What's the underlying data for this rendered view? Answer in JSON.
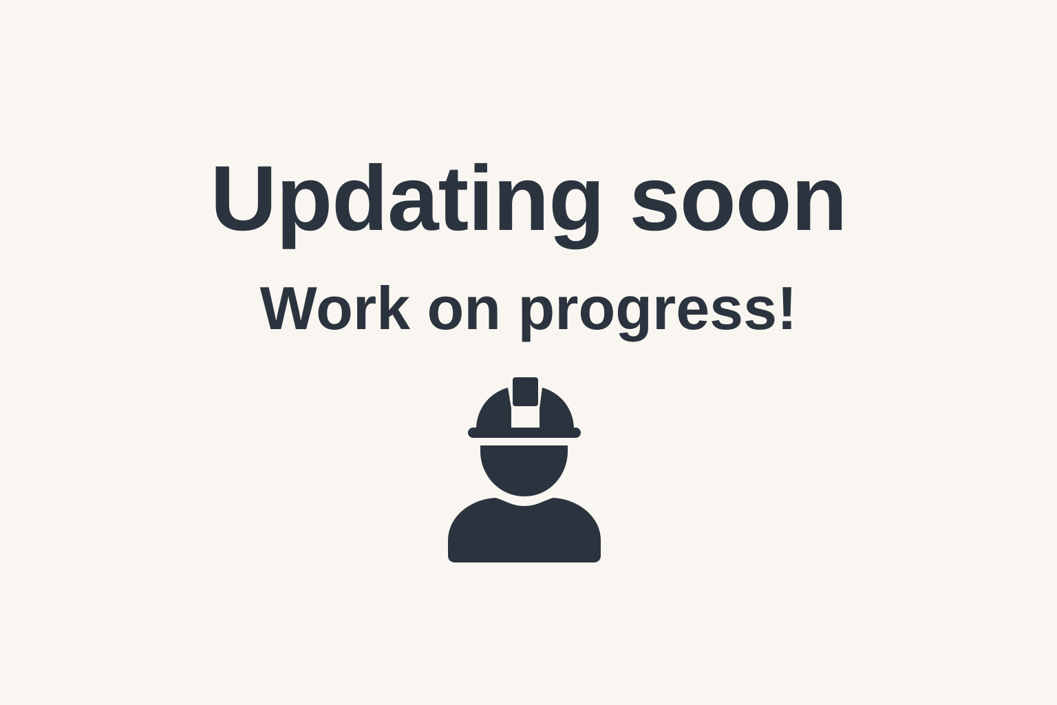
{
  "page": {
    "title": "Updating soon",
    "subtitle": "Work on progress!",
    "icon": "construction-worker-icon"
  },
  "colors": {
    "background": "#f9f6f1",
    "foreground": "#2b343e"
  }
}
